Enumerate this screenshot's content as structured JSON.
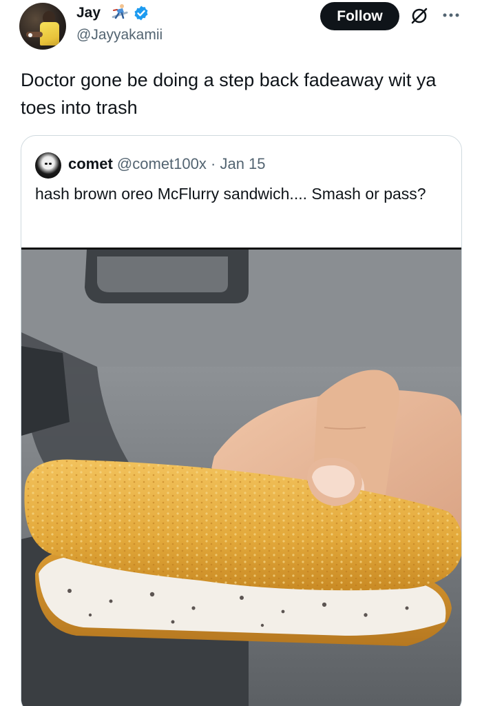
{
  "author": {
    "name": "Jay",
    "handle": "@Jayyakamii",
    "emoji_icon": "skier-emoji-icon",
    "verified_icon": "verified-badge-icon"
  },
  "actions": {
    "follow_label": "Follow",
    "grok_icon": "grok-icon",
    "more_icon": "more-icon"
  },
  "tweet": {
    "text": "Doctor gone be doing a step back fadeaway wit ya toes into trash"
  },
  "quote": {
    "name": "comet",
    "handle": "@comet100x",
    "separator": "·",
    "date": "Jan 15",
    "text": "hash brown oreo McFlurry sandwich.... Smash or pass?"
  },
  "colors": {
    "text_primary": "#0f1419",
    "text_secondary": "#536471",
    "verified_blue": "#1d9bf0",
    "follow_bg": "#0f1419",
    "card_border": "#cfd9de"
  }
}
